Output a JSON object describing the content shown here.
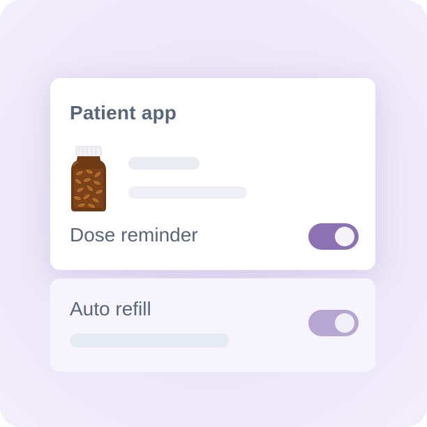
{
  "card": {
    "title": "Patient app",
    "image": "pill-bottle",
    "rows": {
      "dose_reminder": {
        "label": "Dose reminder",
        "toggle_on": true,
        "accent": "#8c72b2"
      }
    }
  },
  "secondary_card": {
    "rows": {
      "auto_refill": {
        "label": "Auto refill",
        "toggle_on": true,
        "accent": "#b6a6d2"
      }
    }
  },
  "colors": {
    "background": "#ece6f8",
    "text": "#5a667a",
    "placeholder": "#e9edf3"
  }
}
